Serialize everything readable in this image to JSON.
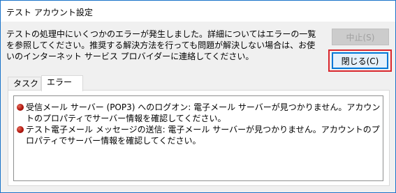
{
  "window": {
    "title": "テスト アカウント設定"
  },
  "message": "テストの処理中にいくつかのエラーが発生しました。詳細についてはエラーの一覧を参照してください。推奨する解決方法を行っても問題が解決しない場合は、お使いのインターネット サービス プロバイダーに連絡してください。",
  "buttons": {
    "stop_label": "中止(S)",
    "close_label": "閉じる(C)"
  },
  "tabs": [
    {
      "label": "タスク",
      "selected": false
    },
    {
      "label": "エラー",
      "selected": true
    }
  ],
  "errors": [
    {
      "icon": "error-dot-icon",
      "text": "受信メール サーバー (POP3) へのログオン: 電子メール サーバーが見つかりません。アカウントのプロパティでサーバー情報を確認してください。"
    },
    {
      "icon": "error-dot-icon",
      "text": "テスト電子メール メッセージの送信: 電子メール サーバーが見つかりません。アカウントのプロパティでサーバー情報を確認してください。"
    }
  ],
  "colors": {
    "highlight_border": "#d9262c",
    "window_border": "#1a73c9",
    "error_icon": "#b2170e"
  }
}
